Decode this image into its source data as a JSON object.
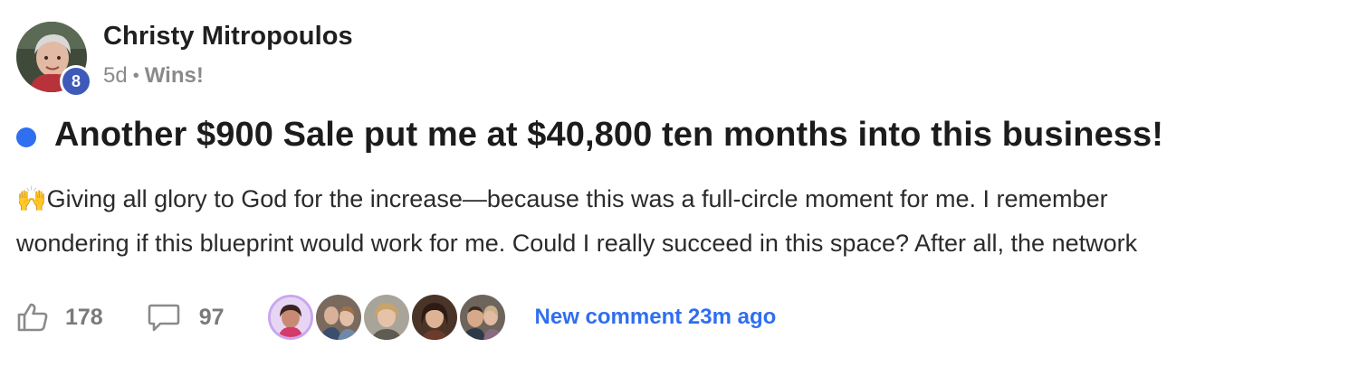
{
  "author": {
    "name": "Christy Mitropoulos",
    "level": "8",
    "time": "5d",
    "separator": "•",
    "category": "Wins!"
  },
  "post": {
    "title": "Another $900 Sale put me at $40,800 ten months into this business!",
    "body_lines": [
      "🙌Giving all glory to God for the increase—because this was a full-circle moment for me. I remember",
      "wondering if this blueprint would work for me. Could I really succeed in this space? After all, the network"
    ]
  },
  "footer": {
    "likes": "178",
    "comments": "97",
    "new_comment_label": "New comment 23m ago",
    "commenter_avatars": [
      "commenter-1",
      "commenter-2",
      "commenter-3",
      "commenter-4",
      "commenter-5"
    ]
  },
  "colors": {
    "accent": "#2f6ff0",
    "level_badge": "#3d5ab8",
    "muted_text": "#8a8a8a"
  },
  "icons": {
    "like": "thumbs-up-icon",
    "comment": "speech-bubble-icon"
  }
}
